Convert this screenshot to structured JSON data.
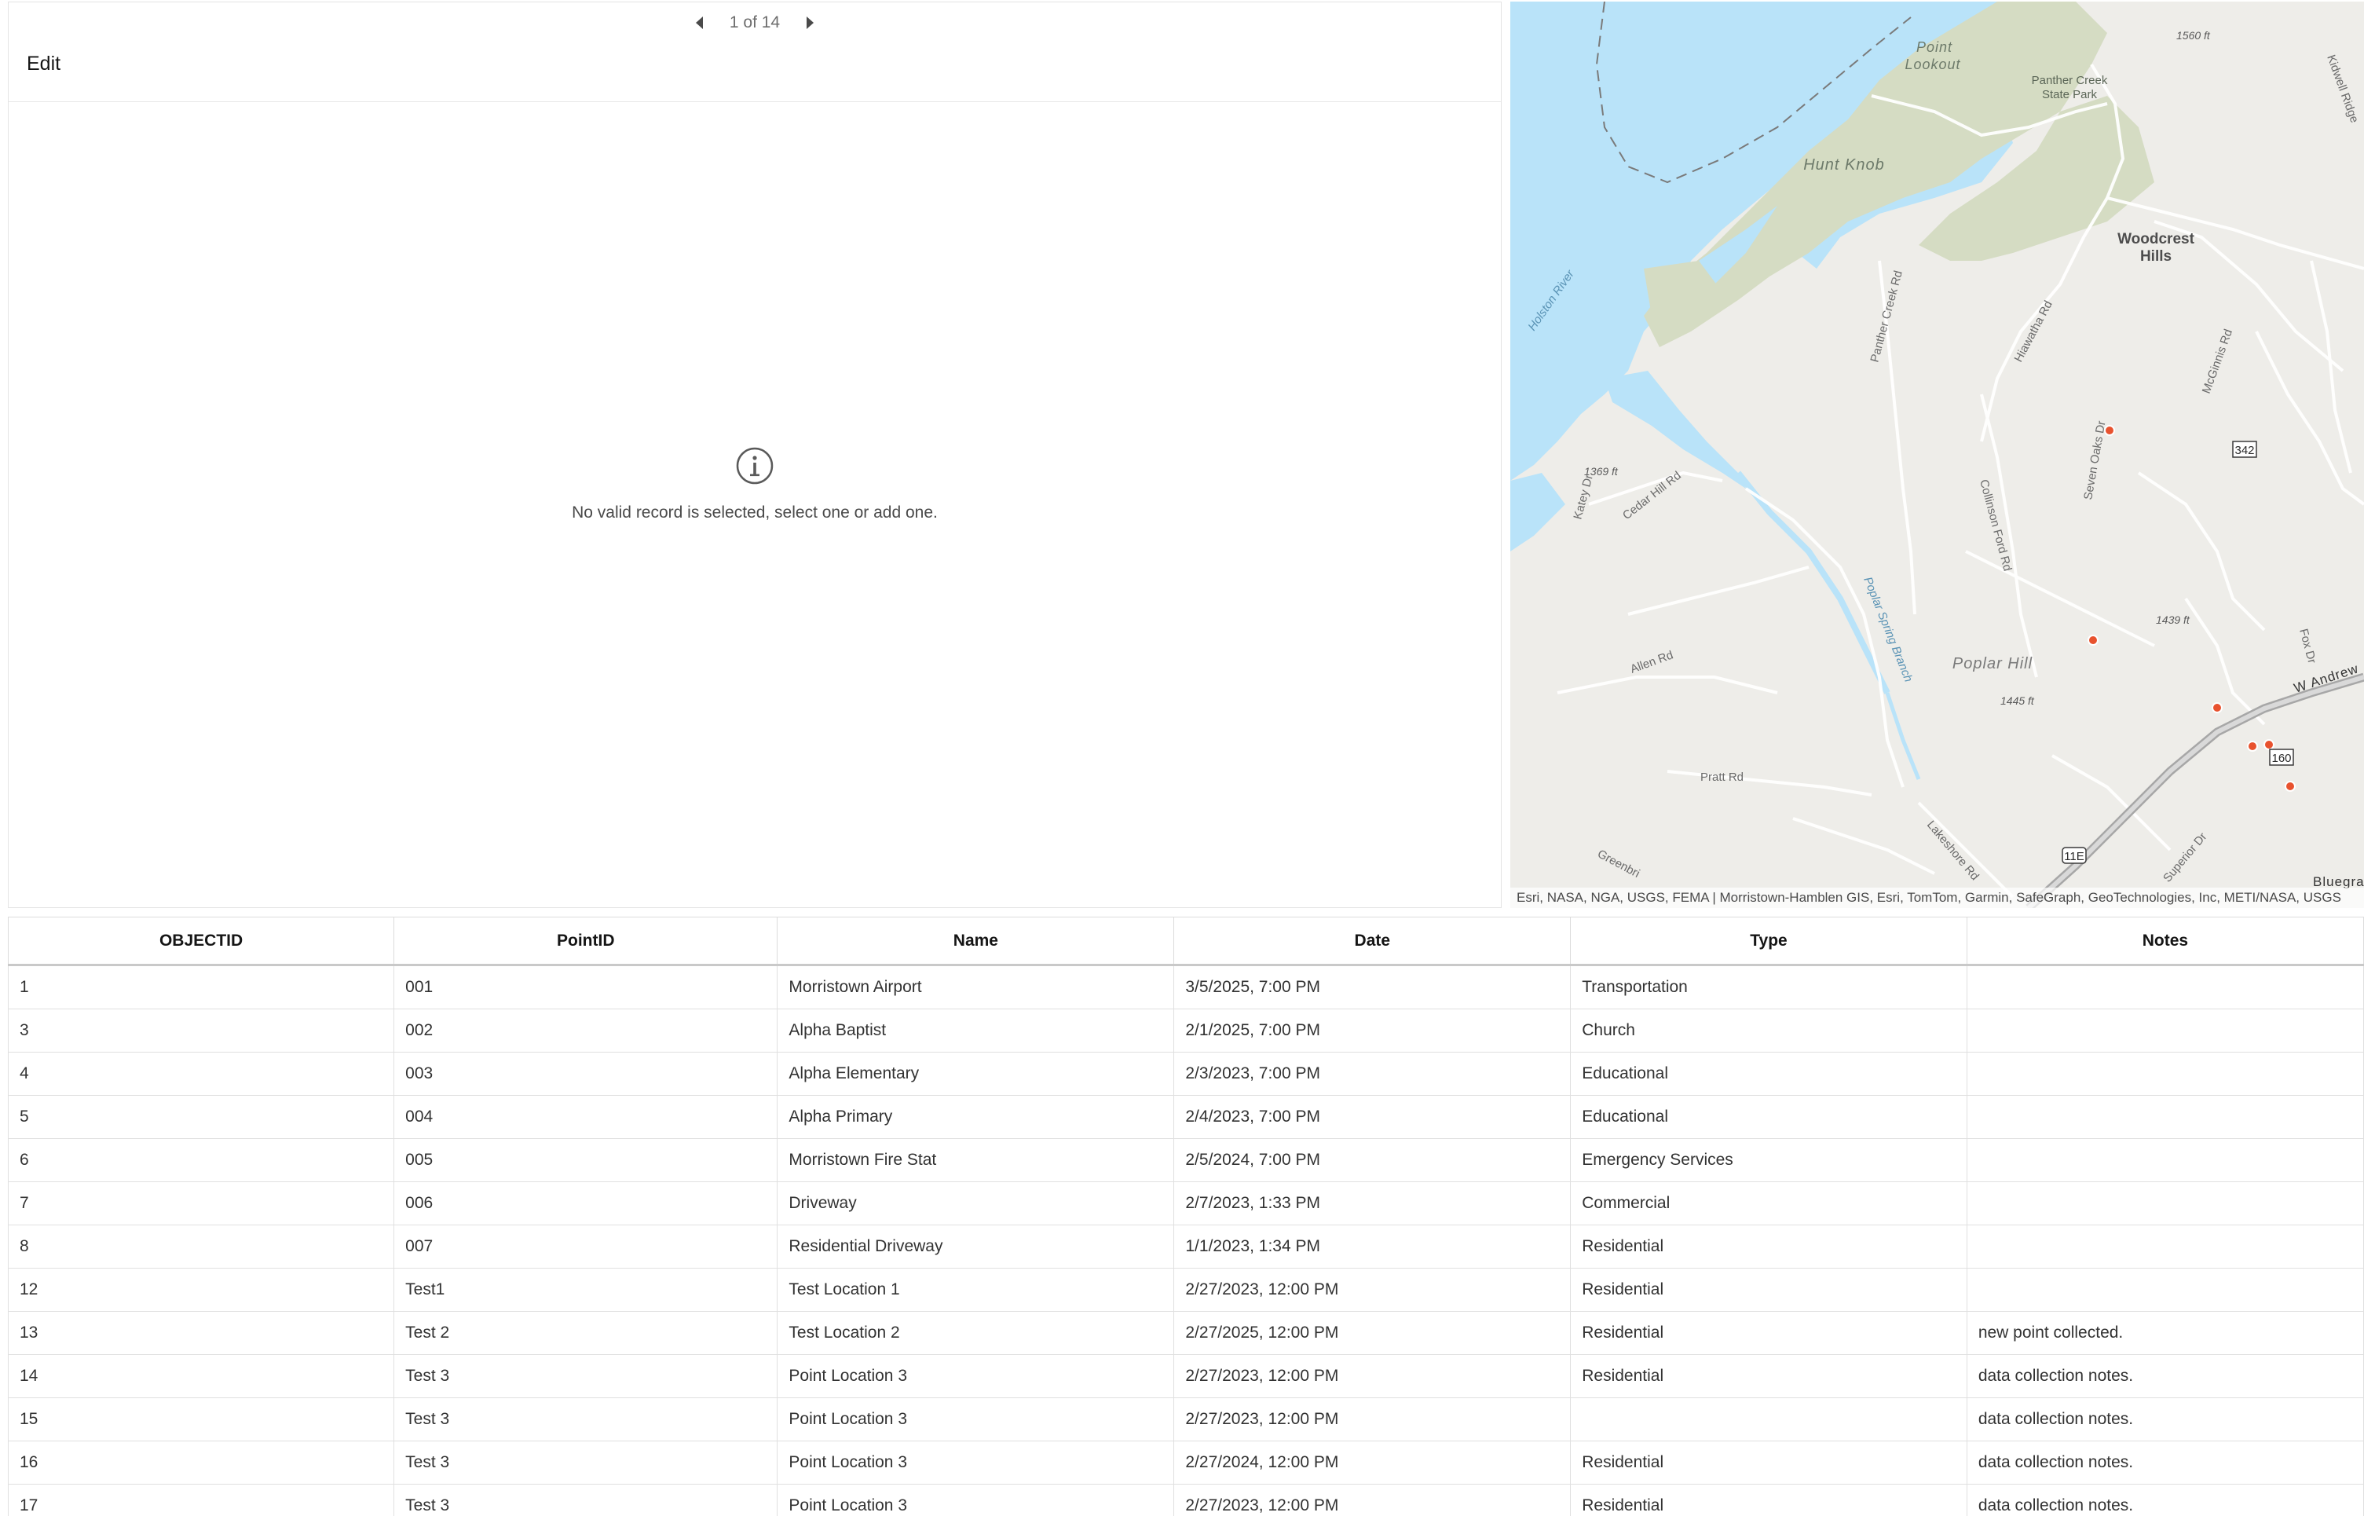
{
  "pager": {
    "text": "1 of 14"
  },
  "edit_panel": {
    "title": "Edit",
    "empty_message": "No valid record is selected, select one or add one."
  },
  "map": {
    "attribution": "Esri, NASA, NGA, USGS, FEMA | Morristown-Hamblen GIS, Esri, TomTom, Garmin, SafeGraph, GeoTechnologies, Inc, METI/NASA, USGS",
    "labels": {
      "point_lookout_1": "Point",
      "point_lookout_2": "Lookout",
      "panther_creek_1": "Panther Creek",
      "panther_creek_2": "State Park",
      "elev_1560": "1560 ft",
      "hunt_knob": "Hunt Knob",
      "woodcrest_1": "Woodcrest",
      "woodcrest_2": "Hills",
      "holston_river": "Holston River",
      "panther_creek_rd": "Panther Creek Rd",
      "hiawatha_rd": "Hiawatha Rd",
      "mcginnis_rd": "McGinnis Rd",
      "seven_oaks_dr": "Seven Oaks Dr",
      "shield_342": "342",
      "elev_1369": "1369 ft",
      "katey_dr": "Katey Dr",
      "cedar_hill_rd": "Cedar Hill Rd",
      "collinson_ford_rd": "Collinson Ford Rd",
      "poplar_spring_branch": "Poplar Spring Branch",
      "elev_1439": "1439 ft",
      "allen_rd": "Allen Rd",
      "poplar_hill": "Poplar Hill",
      "elev_1445": "1445 ft",
      "w_andrew": "W Andrew",
      "fox_dr": "Fox Dr",
      "shield_160": "160",
      "pratt_rd": "Pratt Rd",
      "lakeshore_rd": "Lakeshore Rd",
      "greenbri": "Greenbri",
      "shield_11e": "11E",
      "superior_dr": "Superior Dr",
      "bluegra": "Bluegra",
      "kidwell": "Kidwell Ridge"
    },
    "colors": {
      "water": "#b9e3f9",
      "park": "#d5dcc3",
      "land": "#eeede9",
      "point": "#e8522e"
    }
  },
  "table": {
    "columns": [
      "OBJECTID",
      "PointID",
      "Name",
      "Date",
      "Type",
      "Notes"
    ],
    "rows": [
      [
        "1",
        "001",
        "Morristown Airport",
        "3/5/2025, 7:00 PM",
        "Transportation",
        ""
      ],
      [
        "3",
        "002",
        "Alpha Baptist",
        "2/1/2025, 7:00 PM",
        "Church",
        ""
      ],
      [
        "4",
        "003",
        "Alpha Elementary",
        "2/3/2023, 7:00 PM",
        "Educational",
        ""
      ],
      [
        "5",
        "004",
        "Alpha Primary",
        "2/4/2023, 7:00 PM",
        "Educational",
        ""
      ],
      [
        "6",
        "005",
        "Morristown Fire Stat",
        "2/5/2024, 7:00 PM",
        "Emergency Services",
        ""
      ],
      [
        "7",
        "006",
        "Driveway",
        "2/7/2023, 1:33 PM",
        "Commercial",
        ""
      ],
      [
        "8",
        "007",
        "Residential Driveway",
        "1/1/2023, 1:34 PM",
        "Residential",
        ""
      ],
      [
        "12",
        "Test1",
        "Test Location 1",
        "2/27/2023, 12:00 PM",
        "Residential",
        ""
      ],
      [
        "13",
        "Test 2",
        "Test Location 2",
        "2/27/2025, 12:00 PM",
        "Residential",
        "new point collected."
      ],
      [
        "14",
        "Test 3",
        "Point Location 3",
        "2/27/2023, 12:00 PM",
        "Residential",
        "data collection notes."
      ],
      [
        "15",
        "Test 3",
        "Point Location 3",
        "2/27/2023, 12:00 PM",
        "",
        "data collection notes."
      ],
      [
        "16",
        "Test 3",
        "Point Location 3",
        "2/27/2024, 12:00 PM",
        "Residential",
        "data collection notes."
      ],
      [
        "17",
        "Test 3",
        "Point Location 3",
        "2/27/2023, 12:00 PM",
        "Residential",
        "data collection notes."
      ]
    ]
  }
}
